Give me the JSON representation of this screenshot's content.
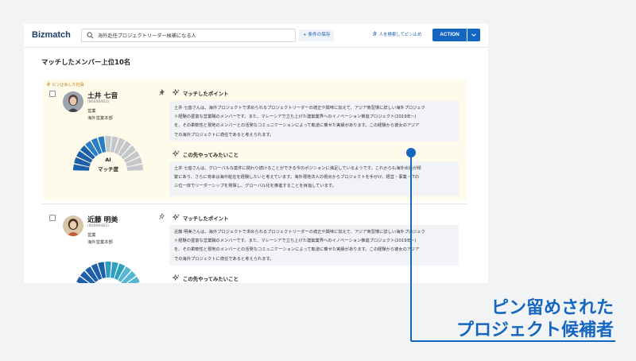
{
  "app": {
    "logo": "Bizmatch"
  },
  "search": {
    "query": "海外赴任プロジェクトリーダー候補になる人"
  },
  "toolbar": {
    "save_condition": "+ 条件の保存",
    "pin_search": "人を検索してピン止め",
    "action": "ACTION"
  },
  "main": {
    "heading": "マッチしたメンバー上位10名"
  },
  "pinned_label": "ピン止めした社員",
  "candidates": [
    {
      "name": "土井 七音",
      "employee_no": "(80006462)",
      "role": "営業",
      "dept": "海外営業本部",
      "gauge_label_1": "AI",
      "gauge_label_2": "マッチ度",
      "match_title": "マッチしたポイント",
      "match_lines": [
        "土井 七音さんは、海外プロジェクトで求められるプロジェクトリーダーの適正や興味に加えて、アジア商習慣に詳しい海外プロジェク",
        "ト経験の豊富な営業職のメンバーです。また、マレーシアで立ち上げた建築業界へのイノベーション推進プロジェクト(2019年~)",
        "を、その柔軟性と現地のメンバーとの活発なコミュニケーションによって軌道に乗せた実績があります。この経験から彼女のアジア",
        "での海外プロジェクトに適任であると考えられます。"
      ],
      "future_title": "この先やってみたいこと",
      "future_lines": [
        "土井 七音さんは、グローバルな案件に関わり続けることができる今のポジションに満足しているようです。これからも海外出張が頻",
        "繁にあり、さらに将来は海外駐在を経験したいと考えています。海外現地法人の視点からプロジェクトを手がけ、経営・事業・ITの",
        "三位一体でリーダーシップを発揮し、グローバル化を推進することを目指しています。"
      ]
    },
    {
      "name": "近藤 明美",
      "employee_no": "(80006462)",
      "role": "営業",
      "dept": "海外営業本部",
      "match_title": "マッチしたポイント",
      "match_lines": [
        "近藤 明美さんは、海外プロジェクトで求められるプロジェクトリーダーの適正や興味に加えて、アジア商習慣に詳しい海外プロジェク",
        "ト経験の豊富な営業職のメンバーです。また、マレーシアで立ち上げた建築業界へのイノベーション推進プロジェクト(2019年~)",
        "を、その柔軟性と現地のメンバーとの活発なコミュニケーションによって軌道に乗せた実績があります。この経験から彼女のアジア",
        "での海外プロジェクトに適任であると考えられます。"
      ],
      "future_title": "この先やってみたいこと"
    }
  ],
  "callout": {
    "line1": "ピン留めされた",
    "line2": "プロジェクト候補者"
  },
  "colors": {
    "accent": "#1566c0",
    "pinned_bg": "#fefbea",
    "gauge_gray": "#c4c8cd"
  }
}
